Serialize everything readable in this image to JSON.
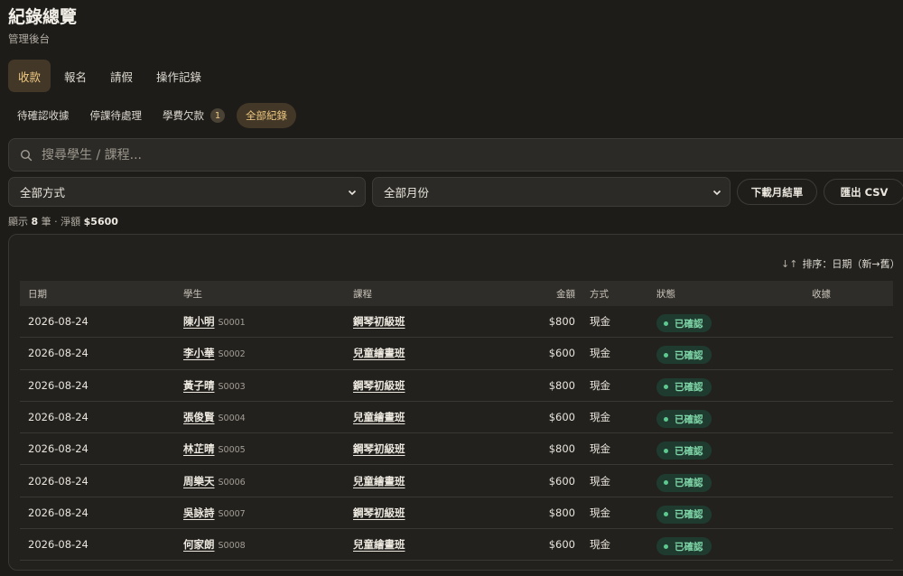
{
  "header": {
    "title": "紀錄總覽",
    "subtitle": "管理後台"
  },
  "main_tabs": [
    {
      "label": "收款",
      "active": true
    },
    {
      "label": "報名",
      "active": false
    },
    {
      "label": "請假",
      "active": false
    },
    {
      "label": "操作記錄",
      "active": false
    }
  ],
  "sub_tabs": [
    {
      "label": "待確認收據",
      "active": false
    },
    {
      "label": "停課待處理",
      "active": false
    },
    {
      "label": "學費欠款",
      "active": false,
      "badge": "1"
    },
    {
      "label": "全部紀錄",
      "active": true
    }
  ],
  "search": {
    "placeholder": "搜尋學生 / 課程...",
    "value": ""
  },
  "filters": {
    "method": "全部方式",
    "month": "全部月份"
  },
  "actions": {
    "download_label": "下載月結單",
    "export_label": "匯出 CSV"
  },
  "summary": {
    "prefix": "顯示",
    "count": "8",
    "count_unit": "筆 · 淨額",
    "total": "$5600"
  },
  "sort": {
    "label": "排序：日期（新→舊）"
  },
  "table": {
    "headers": {
      "date": "日期",
      "student": "學生",
      "course": "課程",
      "amount": "金額",
      "method": "方式",
      "status": "狀態",
      "receipt": "收據"
    },
    "rows": [
      {
        "date": "2026-08-24",
        "student": "陳小明",
        "sid": "S0001",
        "course": "鋼琴初級班",
        "amount": "$800",
        "method": "現金",
        "status": "已確認",
        "receipt": ""
      },
      {
        "date": "2026-08-24",
        "student": "李小華",
        "sid": "S0002",
        "course": "兒童繪畫班",
        "amount": "$600",
        "method": "現金",
        "status": "已確認",
        "receipt": ""
      },
      {
        "date": "2026-08-24",
        "student": "黃子晴",
        "sid": "S0003",
        "course": "鋼琴初級班",
        "amount": "$800",
        "method": "現金",
        "status": "已確認",
        "receipt": ""
      },
      {
        "date": "2026-08-24",
        "student": "張俊賢",
        "sid": "S0004",
        "course": "兒童繪畫班",
        "amount": "$600",
        "method": "現金",
        "status": "已確認",
        "receipt": ""
      },
      {
        "date": "2026-08-24",
        "student": "林芷晴",
        "sid": "S0005",
        "course": "鋼琴初級班",
        "amount": "$800",
        "method": "現金",
        "status": "已確認",
        "receipt": ""
      },
      {
        "date": "2026-08-24",
        "student": "周樂天",
        "sid": "S0006",
        "course": "兒童繪畫班",
        "amount": "$600",
        "method": "現金",
        "status": "已確認",
        "receipt": ""
      },
      {
        "date": "2026-08-24",
        "student": "吳詠詩",
        "sid": "S0007",
        "course": "鋼琴初級班",
        "amount": "$800",
        "method": "現金",
        "status": "已確認",
        "receipt": ""
      },
      {
        "date": "2026-08-24",
        "student": "何家朗",
        "sid": "S0008",
        "course": "兒童繪畫班",
        "amount": "$600",
        "method": "現金",
        "status": "已確認",
        "receipt": ""
      }
    ]
  },
  "colors": {
    "accent": "#f0c983",
    "accent_bg": "#433827",
    "status_text": "#7fd6a8",
    "status_bg": "#1f3b30"
  },
  "icons": {
    "search": "search-icon",
    "chevron": "chevron-down-icon",
    "sort": "sort-arrows-icon"
  }
}
